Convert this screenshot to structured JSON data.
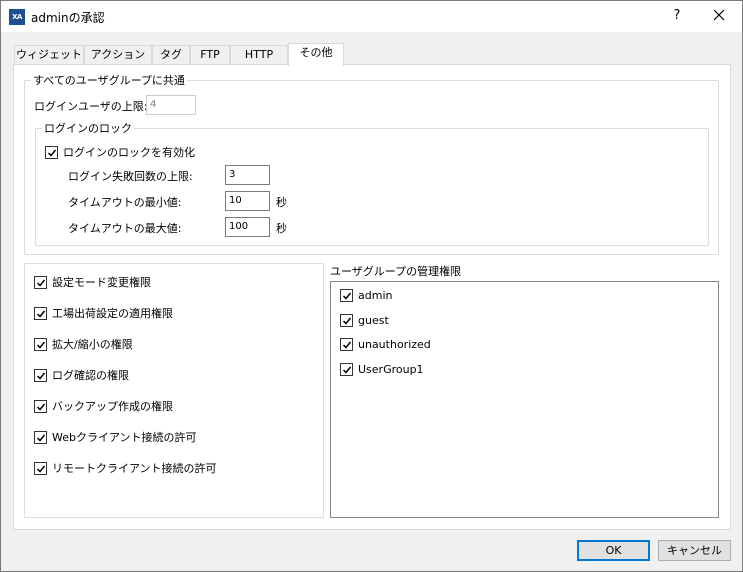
{
  "window": {
    "title": "adminの承認",
    "icon_text": "XA",
    "help": "?"
  },
  "tabs": [
    {
      "label": "ウィジェット",
      "active": false
    },
    {
      "label": "アクション",
      "active": false
    },
    {
      "label": "タグ",
      "active": false
    },
    {
      "label": "FTP",
      "active": false
    },
    {
      "label": "HTTP",
      "active": false
    },
    {
      "label": "その他",
      "active": true
    }
  ],
  "common": {
    "legend": "すべてのユーザグループに共通",
    "user_limit_label": "ログインユーザの上限:",
    "user_limit_value": "4",
    "lock": {
      "legend": "ログインのロック",
      "enable_label": "ログインのロックを有効化",
      "enable_checked": true,
      "fail_label": "ログイン失敗回数の上限:",
      "fail_value": "3",
      "timeout_min_label": "タイムアウトの最小値:",
      "timeout_min_value": "10",
      "timeout_max_label": "タイムアウトの最大値:",
      "timeout_max_value": "100",
      "unit": "秒"
    }
  },
  "permissions": [
    {
      "label": "設定モード変更権限",
      "checked": true
    },
    {
      "label": "工場出荷設定の適用権限",
      "checked": true
    },
    {
      "label": "拡大/縮小の権限",
      "checked": true
    },
    {
      "label": "ログ確認の権限",
      "checked": true
    },
    {
      "label": "バックアップ作成の権限",
      "checked": true
    },
    {
      "label": "Webクライアント接続の許可",
      "checked": true
    },
    {
      "label": "リモートクライアント接続の許可",
      "checked": true
    }
  ],
  "user_groups": {
    "label": "ユーザグループの管理権限",
    "items": [
      {
        "label": "admin",
        "checked": true
      },
      {
        "label": "guest",
        "checked": true
      },
      {
        "label": "unauthorized",
        "checked": true
      },
      {
        "label": "UserGroup1",
        "checked": true
      }
    ]
  },
  "buttons": {
    "ok": "OK",
    "cancel": "キャンセル"
  }
}
